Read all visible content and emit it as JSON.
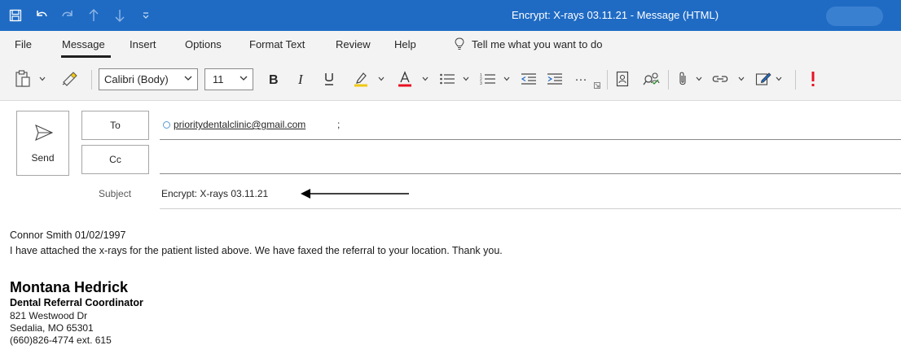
{
  "window": {
    "title": "Encrypt: X-rays 03.11.21  -  Message (HTML)",
    "quick_access": [
      "save-icon",
      "undo-icon",
      "redo-icon",
      "up-arrow-icon",
      "down-arrow-icon",
      "customize-dropdown-icon"
    ]
  },
  "menu": {
    "tabs": [
      "File",
      "Message",
      "Insert",
      "Options",
      "Format Text",
      "Review",
      "Help"
    ],
    "active_tab": "Message",
    "tell_me": "Tell me what you want to do"
  },
  "ribbon": {
    "font_name": "Calibri (Body)",
    "font_size": "11",
    "more_label": "···"
  },
  "compose": {
    "send_label": "Send",
    "to_label": "To",
    "cc_label": "Cc",
    "to_address": "prioritydentalclinic@gmail.com",
    "to_separator": ";",
    "cc_value": "",
    "subject_label": "Subject",
    "subject_value": "Encrypt: X-rays 03.11.21"
  },
  "body": {
    "line1": "Connor Smith 01/02/1997",
    "line2": "I have attached the x-rays for the patient listed above. We have faxed the referral to your location. Thank you."
  },
  "signature": {
    "name": "Montana Hedrick",
    "title": "Dental Referral Coordinator",
    "address1": "821 Westwood Dr",
    "address2": "Sedalia, MO 65301",
    "phone": "(660)826-4774 ext. 615"
  },
  "colors": {
    "title_bar": "#1f6bc4",
    "highlight": "#f2c811",
    "font_color": "#e81123",
    "importance": "#e81123"
  }
}
